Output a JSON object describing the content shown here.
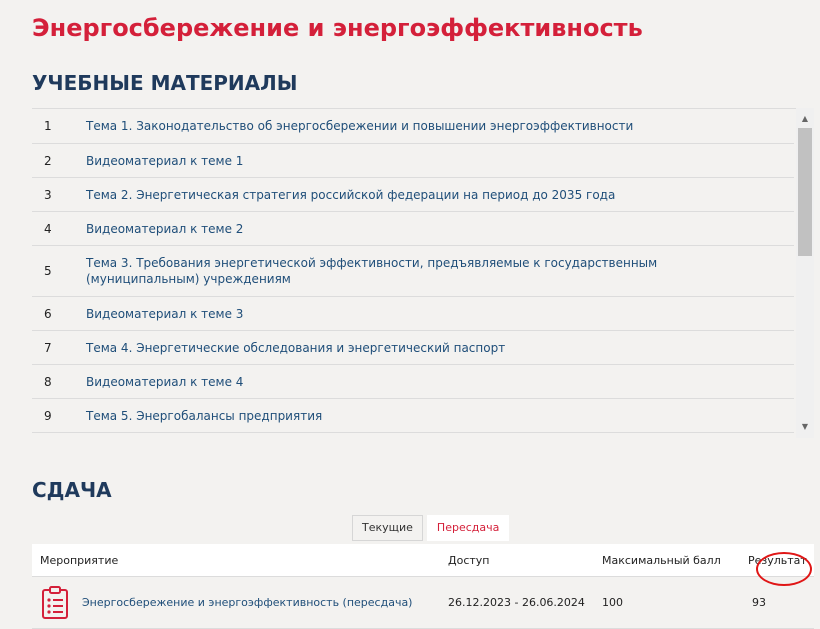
{
  "page_title": "Энергосбережение и энергоэффективность",
  "materials": {
    "title": "УЧЕБНЫЕ МАТЕРИАЛЫ",
    "items": [
      {
        "num": "1",
        "label": "Тема 1. Законодательство об энергосбережении и повышении энергоэффективности"
      },
      {
        "num": "2",
        "label": "Видеоматериал к теме 1"
      },
      {
        "num": "3",
        "label": "Тема 2. Энергетическая стратегия российской федерации на период до 2035 года"
      },
      {
        "num": "4",
        "label": "Видеоматериал к теме 2"
      },
      {
        "num": "5",
        "label": "Тема 3. Требования энергетической эффективности, предъявляемые к государственным (муниципальным) учреждениям"
      },
      {
        "num": "6",
        "label": "Видеоматериал к теме 3"
      },
      {
        "num": "7",
        "label": "Тема 4. Энергетические обследования и энергетический паспорт"
      },
      {
        "num": "8",
        "label": "Видеоматериал к теме 4"
      },
      {
        "num": "9",
        "label": "Тема 5. Энергобалансы предприятия"
      }
    ]
  },
  "submission": {
    "title": "СДАЧА",
    "tabs": [
      {
        "label": "Текущие",
        "active": false
      },
      {
        "label": "Пересдача",
        "active": true
      }
    ],
    "columns": {
      "event": "Мероприятие",
      "access": "Доступ",
      "max_score": "Максимальный балл",
      "result": "Результат"
    },
    "rows": [
      {
        "icon": "clipboard-icon",
        "event": "Энергосбережение и энергоэффективность (пересдача)",
        "access": "26.12.2023 - 26.06.2024",
        "max_score": "100",
        "result": "93"
      }
    ]
  },
  "colors": {
    "accent": "#d4203a",
    "heading": "#1f3a5c",
    "link": "#1f4e79",
    "highlight": "#e01616"
  }
}
